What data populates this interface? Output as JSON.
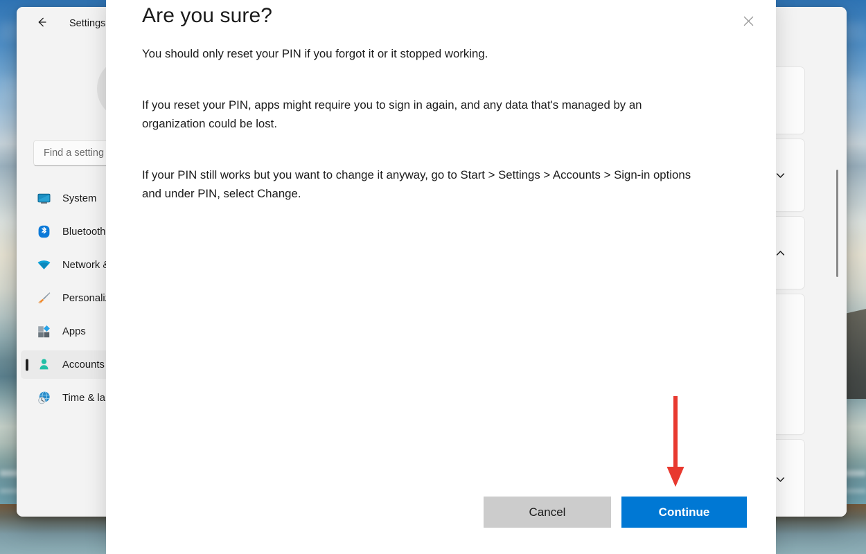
{
  "window": {
    "app_title": "Settings",
    "back_icon": "arrow-left-icon",
    "avatar_icon": "person-avatar-icon",
    "search_placeholder": "Find a setting"
  },
  "sidebar": {
    "items": [
      {
        "label": "System",
        "icon": "monitor-icon",
        "selected": false
      },
      {
        "label": "Bluetooth & devices",
        "icon": "bluetooth-icon",
        "selected": false
      },
      {
        "label": "Network & internet",
        "icon": "wifi-icon",
        "selected": false
      },
      {
        "label": "Personalization",
        "icon": "paintbrush-icon",
        "selected": false
      },
      {
        "label": "Apps",
        "icon": "apps-icon",
        "selected": false
      },
      {
        "label": "Accounts",
        "icon": "person-icon",
        "selected": true
      },
      {
        "label": "Time & language",
        "icon": "clock-globe-icon",
        "selected": false
      }
    ]
  },
  "content": {
    "cards": [
      {
        "chevron": "chevron-down-icon"
      },
      {
        "chevron": "chevron-down-icon"
      },
      {
        "chevron": "chevron-up-icon"
      },
      {
        "chevron": ""
      },
      {
        "chevron": "chevron-down-icon"
      }
    ]
  },
  "dialog": {
    "close_icon": "close-icon",
    "title": "Are you sure?",
    "paragraph_1": "You should only reset your PIN if you forgot it or it stopped working.",
    "paragraph_2": "If you reset your PIN, apps might require you to sign in again, and any data that's managed by an organization could be lost.",
    "paragraph_3": "If your PIN still works but you want to change it anyway, go to Start > Settings > Accounts > Sign-in options and under PIN, select Change.",
    "cancel_label": "Cancel",
    "continue_label": "Continue"
  },
  "annotation": {
    "arrow_icon": "red-down-arrow-icon",
    "arrow_color": "#e8392f"
  },
  "colors": {
    "accent": "#0078d4",
    "cancel_button": "#cccccc",
    "window_background": "#f3f3f3",
    "dialog_background": "#ffffff"
  }
}
